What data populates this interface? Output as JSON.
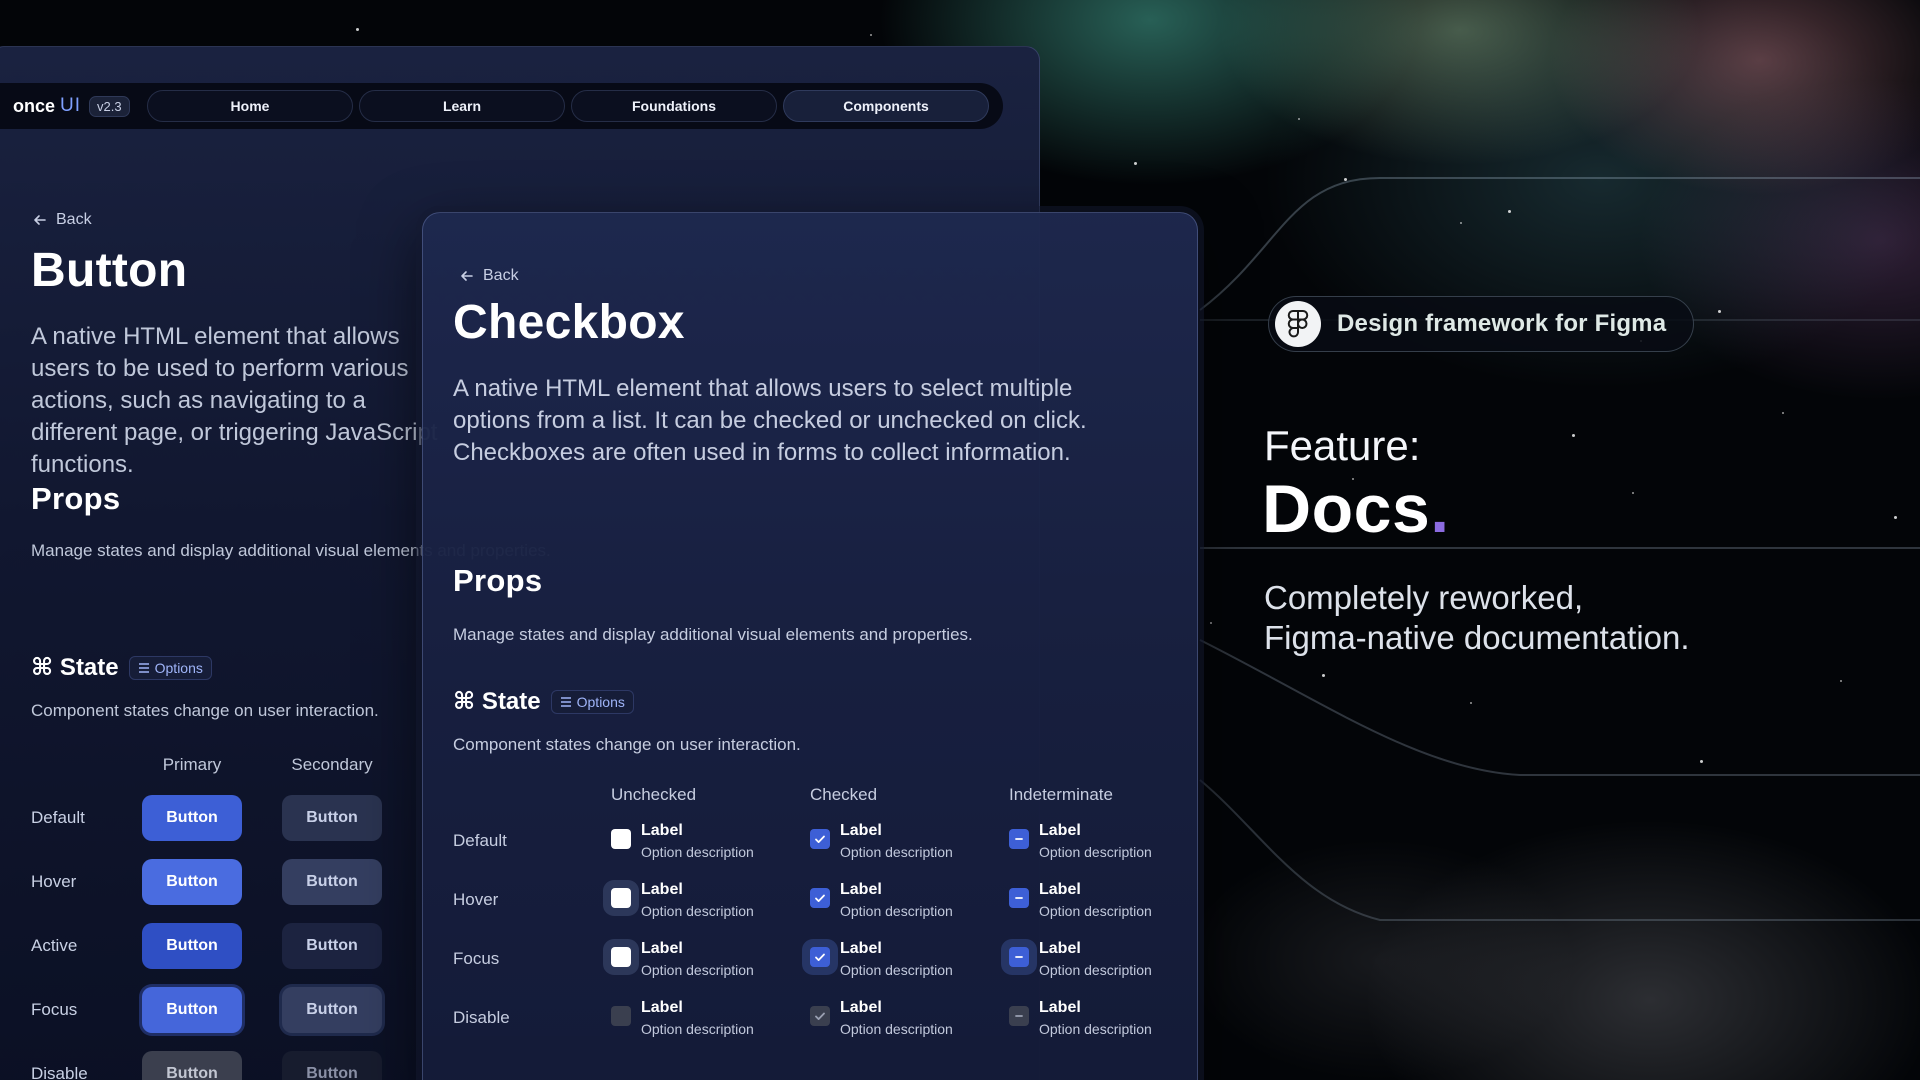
{
  "colors": {
    "accent": "#3d5fd6",
    "brand_ui": "#7fa0ff",
    "docs_dot": "#8b6be0"
  },
  "button_window": {
    "brand": {
      "name": "once",
      "suffix": "UI",
      "version": "v2.3"
    },
    "nav": [
      "Home",
      "Learn",
      "Foundations",
      "Components"
    ],
    "active_nav": "Components",
    "back_label": "Back",
    "title": "Button",
    "description": "A native HTML element that allows users to be used to perform various actions, such as navigating to a different page, or triggering JavaScript functions.",
    "props_title": "Props",
    "props_desc": "Manage states and display additional visual elements and properties.",
    "state_title": "⌘ State",
    "options_label": "Options",
    "state_desc": "Component states change on user interaction.",
    "columns": [
      "Primary",
      "Secondary"
    ],
    "rows": [
      "Default",
      "Hover",
      "Active",
      "Focus",
      "Disable"
    ],
    "button_label": "Button"
  },
  "checkbox_window": {
    "back_label": "Back",
    "title": "Checkbox",
    "description": "A native HTML element that allows users to select multiple options from a list. It can be checked or unchecked on click. Checkboxes are often used in forms to collect information.",
    "props_title": "Props",
    "props_desc": "Manage states and display additional visual elements and properties.",
    "state_title": "⌘ State",
    "options_label": "Options",
    "state_desc": "Component states change on user interaction.",
    "columns": [
      "Unchecked",
      "Checked",
      "Indeterminate"
    ],
    "rows": [
      "Default",
      "Hover",
      "Focus",
      "Disable"
    ],
    "item_label": "Label",
    "item_desc": "Option description"
  },
  "feature": {
    "pill_text": "Design framework for Figma",
    "label": "Feature:",
    "title": "Docs",
    "title_dot": ".",
    "desc_line1": "Completely reworked,",
    "desc_line2": "Figma-native documentation."
  }
}
